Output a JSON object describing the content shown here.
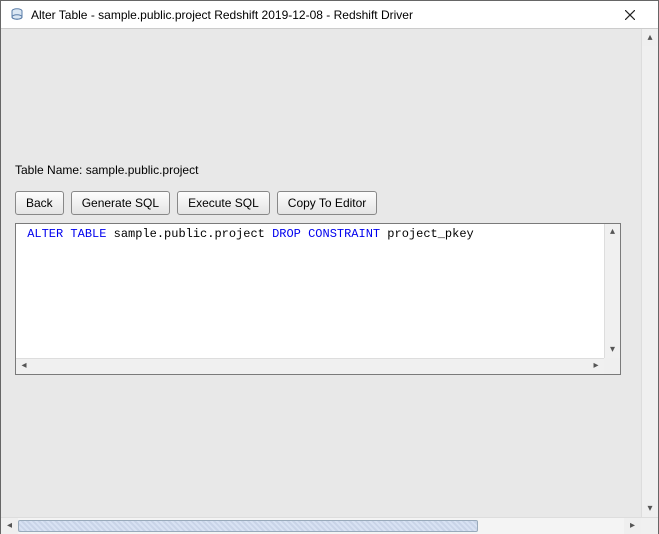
{
  "window": {
    "title": "Alter Table - sample.public.project Redshift 2019-12-08 - Redshift Driver"
  },
  "labels": {
    "table_name_prefix": "Table Name:",
    "table_name_value": "sample.public.project"
  },
  "buttons": {
    "back": "Back",
    "generate_sql": "Generate SQL",
    "execute_sql": "Execute SQL",
    "copy_to_editor": "Copy To Editor"
  },
  "sql": {
    "tokens": [
      {
        "t": "ALTER",
        "kw": true
      },
      {
        "t": " ",
        "kw": false
      },
      {
        "t": "TABLE",
        "kw": true
      },
      {
        "t": " sample.public.project ",
        "kw": false
      },
      {
        "t": "DROP",
        "kw": true
      },
      {
        "t": " ",
        "kw": false
      },
      {
        "t": "CONSTRAINT",
        "kw": true
      },
      {
        "t": " project_pkey",
        "kw": false
      }
    ]
  }
}
